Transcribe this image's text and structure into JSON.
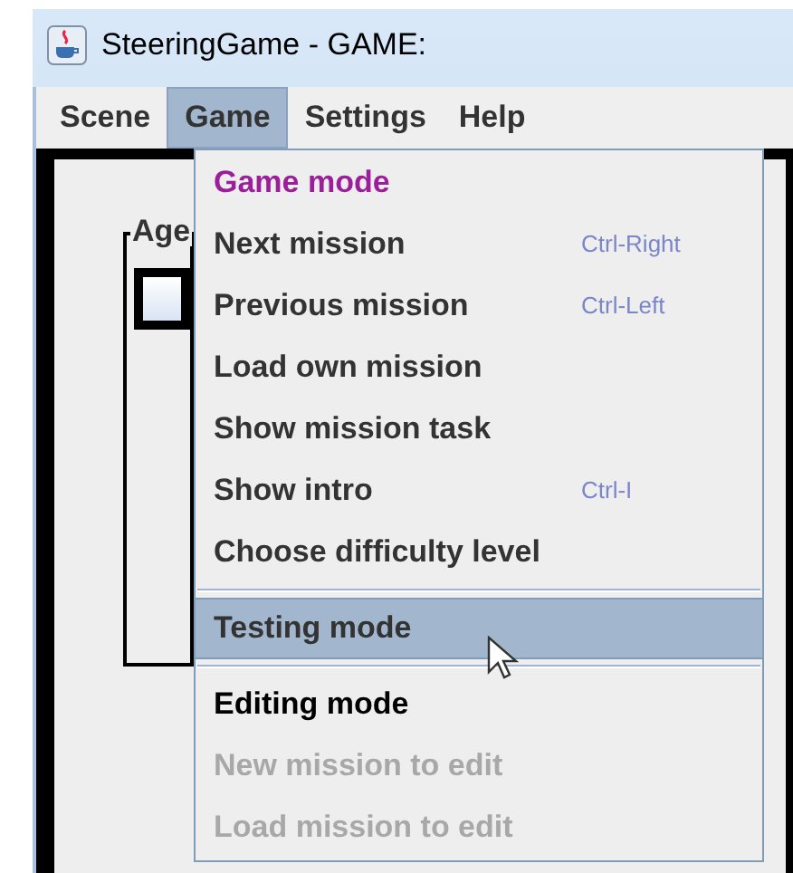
{
  "window": {
    "title": "SteeringGame - GAME:"
  },
  "menu_bar": [
    {
      "label": "Scene",
      "selected": false
    },
    {
      "label": "Game",
      "selected": true
    },
    {
      "label": "Settings",
      "selected": false
    },
    {
      "label": "Help",
      "selected": false
    }
  ],
  "background": {
    "group_label": "Age"
  },
  "menu": [
    {
      "kind": "header",
      "label": "Game mode",
      "active": true,
      "selected": false,
      "disabled": false
    },
    {
      "kind": "item",
      "label": "Next mission",
      "shortcut": "Ctrl-Right",
      "selected": false,
      "disabled": false
    },
    {
      "kind": "item",
      "label": "Previous mission",
      "shortcut": "Ctrl-Left",
      "selected": false,
      "disabled": false
    },
    {
      "kind": "item",
      "label": "Load own mission",
      "selected": false,
      "disabled": false
    },
    {
      "kind": "item",
      "label": "Show mission task",
      "selected": false,
      "disabled": false
    },
    {
      "kind": "item",
      "label": "Show intro",
      "shortcut": "Ctrl-I",
      "selected": false,
      "disabled": false
    },
    {
      "kind": "item",
      "label": "Choose difficulty level",
      "selected": false,
      "disabled": false
    },
    {
      "kind": "separator"
    },
    {
      "kind": "item",
      "label": "Testing mode",
      "selected": true,
      "disabled": false
    },
    {
      "kind": "separator"
    },
    {
      "kind": "header",
      "label": "Editing mode",
      "active": false,
      "selected": false,
      "disabled": false
    },
    {
      "kind": "item",
      "label": "New mission to edit",
      "selected": false,
      "disabled": true
    },
    {
      "kind": "item",
      "label": "Load mission to edit",
      "selected": false,
      "disabled": true
    }
  ]
}
